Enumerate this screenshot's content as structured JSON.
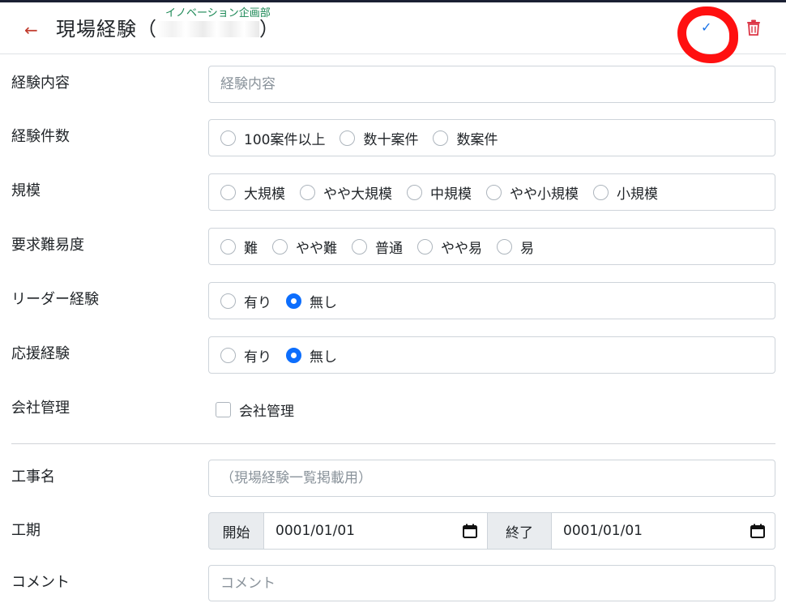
{
  "header": {
    "title": "現場経験（",
    "title_close": "）",
    "department": "イノベーション企画部",
    "back_label": "←",
    "save_label": "✓"
  },
  "form": {
    "content": {
      "label": "経験内容",
      "placeholder": "経験内容"
    },
    "count": {
      "label": "経験件数",
      "options": [
        "100案件以上",
        "数十案件",
        "数案件"
      ]
    },
    "scale": {
      "label": "規模",
      "options": [
        "大規模",
        "やや大規模",
        "中規模",
        "やや小規模",
        "小規模"
      ]
    },
    "difficulty": {
      "label": "要求難易度",
      "options": [
        "難",
        "やや難",
        "普通",
        "やや易",
        "易"
      ]
    },
    "leader": {
      "label": "リーダー経験",
      "options": [
        "有り",
        "無し"
      ],
      "selected": "無し"
    },
    "support": {
      "label": "応援経験",
      "options": [
        "有り",
        "無し"
      ],
      "selected": "無し"
    },
    "company": {
      "label": "会社管理",
      "checkbox_label": "会社管理",
      "checked": false
    },
    "work_name": {
      "label": "工事名",
      "placeholder": "（現場経験一覧掲載用）"
    },
    "period": {
      "label": "工期",
      "start_label": "開始",
      "start_value": "0001/01/01",
      "end_label": "終了",
      "end_value": "0001/01/01"
    },
    "comment": {
      "label": "コメント",
      "placeholder": "コメント"
    }
  },
  "colors": {
    "accent": "#0d6efd",
    "back": "#c0392b",
    "delete": "#dc3545",
    "annotation": "#ff1010",
    "department": "#198754"
  },
  "icons": {
    "back": "arrow-left-icon",
    "save": "check-icon",
    "delete": "trash-icon",
    "calendar": "calendar-icon"
  }
}
